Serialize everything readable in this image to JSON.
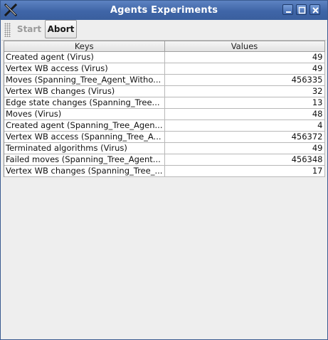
{
  "window": {
    "title": "Agents Experiments",
    "colors": {
      "titlebar": "#4a6fae",
      "background": "#eeeeee"
    }
  },
  "window_controls": [
    "minimize-icon",
    "maximize-icon",
    "close-icon"
  ],
  "toolbar": {
    "start_label": "Start",
    "abort_label": "Abort"
  },
  "table": {
    "columns": [
      "Keys",
      "Values"
    ],
    "rows": [
      {
        "key": "Created agent (Virus)",
        "value": "49"
      },
      {
        "key": "Vertex WB access (Virus)",
        "value": "49"
      },
      {
        "key": "Moves (Spanning_Tree_Agent_Witho...",
        "value": "456335"
      },
      {
        "key": "Vertex WB changes (Virus)",
        "value": "32"
      },
      {
        "key": "Edge state changes (Spanning_Tree...",
        "value": "13"
      },
      {
        "key": "Moves (Virus)",
        "value": "48"
      },
      {
        "key": "Created agent (Spanning_Tree_Agen...",
        "value": "4"
      },
      {
        "key": "Vertex WB access (Spanning_Tree_A...",
        "value": "456372"
      },
      {
        "key": "Terminated algorithms (Virus)",
        "value": "49"
      },
      {
        "key": "Failed moves (Spanning_Tree_Agent...",
        "value": "456348"
      },
      {
        "key": "Vertex WB changes (Spanning_Tree_...",
        "value": "17"
      }
    ]
  }
}
